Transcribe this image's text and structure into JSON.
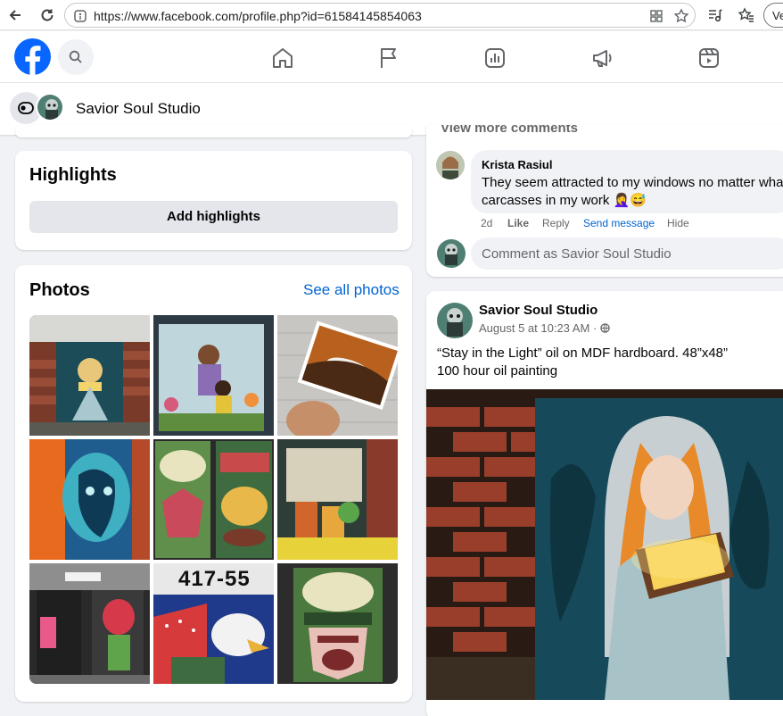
{
  "browser": {
    "url": "https://www.facebook.com/profile.php?id=61584145854063",
    "profile_chip": "Ve"
  },
  "page": {
    "name": "Savior Soul Studio"
  },
  "highlights": {
    "title": "Highlights",
    "add_button": "Add highlights"
  },
  "photos": {
    "title": "Photos",
    "see_all": "See all photos",
    "items": [
      {
        "icon": "painting-girl-reading"
      },
      {
        "icon": "mural-mother-child"
      },
      {
        "icon": "postcard-bird"
      },
      {
        "icon": "abstract-face"
      },
      {
        "icon": "route-66-pasta"
      },
      {
        "icon": "sip-local-window"
      },
      {
        "icon": "soda-pop-storefront"
      },
      {
        "icon": "eagle-flag-mural"
      },
      {
        "icon": "route-66-sign"
      }
    ],
    "overlay_number": "417-55"
  },
  "comments": {
    "view_more": "View more comments",
    "comment": {
      "author": "Krista Rasiul",
      "text": "They seem attracted to my windows no matter wha carcasses in my work 🤦‍♀️😅",
      "time": "2d",
      "like": "Like",
      "reply": "Reply",
      "send_message": "Send message",
      "hide": "Hide"
    },
    "input_placeholder": "Comment as Savior Soul Studio"
  },
  "post": {
    "author": "Savior Soul Studio",
    "time": "August 5 at 10:23 AM · ",
    "text_line1": "“Stay in the Light” oil on MDF hardboard. 48”x48”",
    "text_line2": "100 hour oil painting"
  },
  "colors": {
    "brand": "#0866ff",
    "link": "#0064d1",
    "background": "#f0f2f5"
  }
}
